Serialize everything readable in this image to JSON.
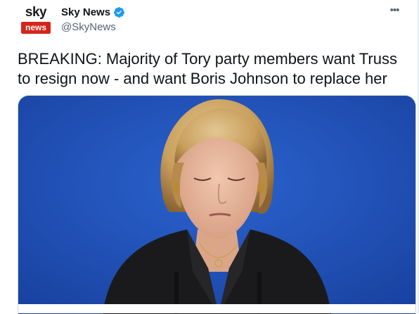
{
  "account": {
    "display_name": "Sky News",
    "handle": "@SkyNews",
    "avatar_text_top": "sky",
    "avatar_text_bottom": "news",
    "verified": true
  },
  "tweet": {
    "text": "BREAKING: Majority of Tory party members want Truss to resign now - and want Boris Johnson to replace her"
  },
  "menu": {
    "more_label": "•••"
  },
  "colors": {
    "text": "#0f1419",
    "secondary": "#536471",
    "verified_blue": "#1d9bf0",
    "sky_red": "#d6241b",
    "photo_background": "#1d4fb8"
  },
  "icons": {
    "verified": "verified-badge-icon",
    "more": "more-options-icon"
  }
}
